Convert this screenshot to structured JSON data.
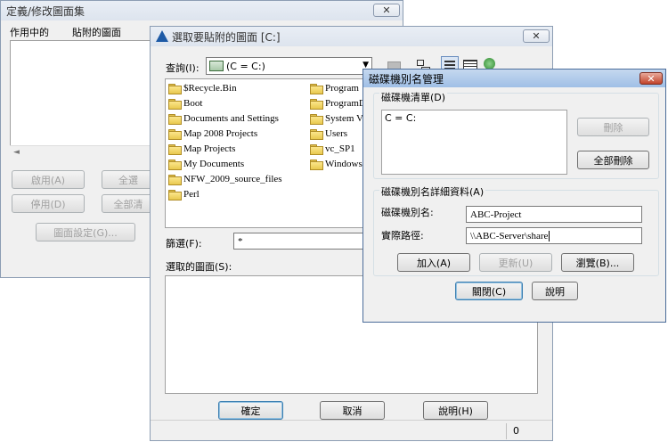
{
  "win1": {
    "title": "定義/修改圖面集",
    "col_active": "作用中的",
    "col_attached": "貼附的圖面",
    "btn_enable": "啟用(A)",
    "btn_select_all": "全選",
    "btn_disable": "停用(D)",
    "btn_clear_all": "全部清",
    "btn_drawing_settings": "圖面設定(G)..."
  },
  "win2": {
    "title": "選取要貼附的圖面 [C:]",
    "lookin_label": "查詢(I):",
    "lookin_value": "(C = C:)",
    "folders": [
      "$Recycle.Bin",
      "Boot",
      "Documents and Settings",
      "Map 2008 Projects",
      "Map Projects",
      "My Documents",
      "NFW_2009_source_files",
      "Perl",
      "Program",
      "ProgramD",
      "System V",
      "Users",
      "vc_SP1",
      "Windows"
    ],
    "filter_label": "篩選(F):",
    "filter_value": "*",
    "selected_label": "選取的圖面(S):",
    "btn_ok": "確定",
    "btn_cancel": "取消",
    "btn_help": "說明(H)",
    "status_count": "0"
  },
  "win3": {
    "title": "磁碟機別名管理",
    "list_label": "磁碟機清單(D)",
    "list_items": [
      "C = C:"
    ],
    "btn_delete": "刪除",
    "btn_delete_all": "全部刪除",
    "detail_label": "磁碟機別名詳細資料(A)",
    "alias_label": "磁碟機別名:",
    "alias_value": "ABC-Project",
    "path_label": "實際路徑:",
    "path_value": "\\\\ABC-Server\\share",
    "btn_add": "加入(A)",
    "btn_update": "更新(U)",
    "btn_browse": "瀏覽(B)...",
    "btn_close": "關閉(C)",
    "btn_help": "說明"
  }
}
